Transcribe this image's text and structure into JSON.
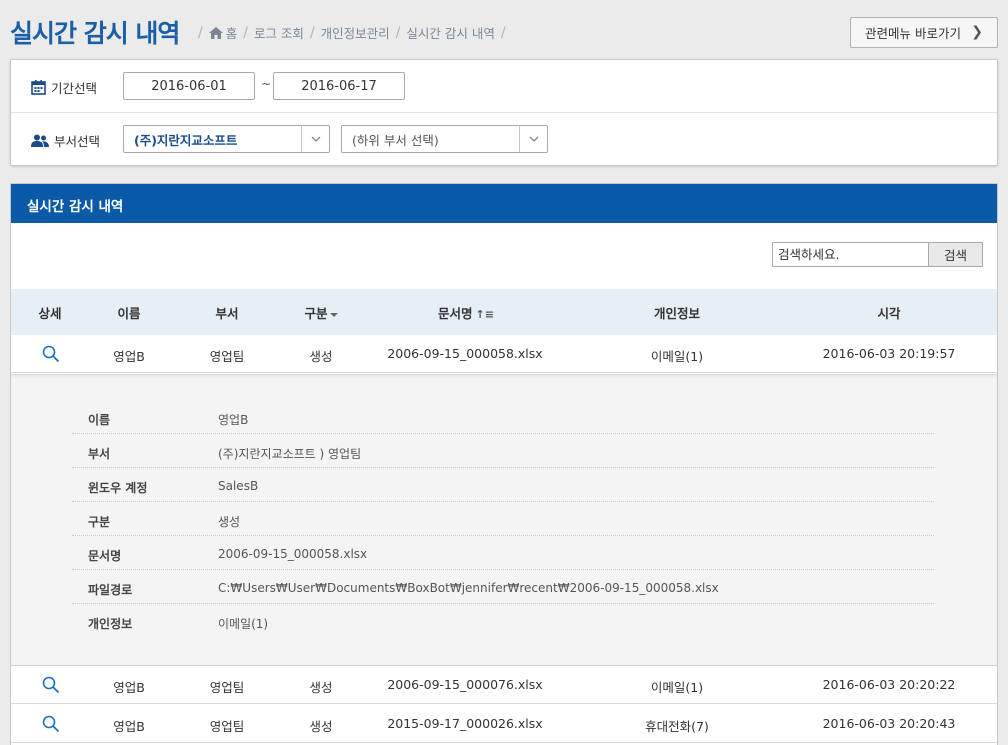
{
  "header": {
    "title": "실시간 감시 내역",
    "breadcrumb": [
      "홈",
      "로그 조회",
      "개인정보관리",
      "실시간 감시 내역"
    ],
    "related_button": "관련메뉴 바로가기"
  },
  "filter": {
    "period_label": "기간선택",
    "start_date": "2016-06-01",
    "separator": "~",
    "end_date": "2016-06-17",
    "dept_label": "부서선택",
    "dept_selected": "(주)지란지교소프트",
    "subdept_selected": "(하위 부서 선택)"
  },
  "panel": {
    "title": "실시간 감시 내역",
    "search_placeholder": "검색하세요.",
    "search_button": "검색"
  },
  "table": {
    "columns": [
      "상세",
      "이름",
      "부서",
      "구분",
      "문서명",
      "개인정보",
      "시각"
    ],
    "rows": [
      {
        "name": "영업B",
        "dept": "영업팀",
        "type": "생성",
        "doc": "2006-09-15_000058.xlsx",
        "pii": "이메일(1)",
        "time": "2016-06-03 20:19:57"
      },
      {
        "name": "영업B",
        "dept": "영업팀",
        "type": "생성",
        "doc": "2006-09-15_000076.xlsx",
        "pii": "이메일(1)",
        "time": "2016-06-03 20:20:22"
      },
      {
        "name": "영업B",
        "dept": "영업팀",
        "type": "생성",
        "doc": "2015-09-17_000026.xlsx",
        "pii": "휴대전화(7)",
        "time": "2016-06-03 20:20:43"
      }
    ]
  },
  "detail": [
    {
      "key": "이름",
      "value": "영업B"
    },
    {
      "key": "부서",
      "value": "(주)지란지교소프트 ) 영업팀"
    },
    {
      "key": "윈도우 계정",
      "value": "SalesB"
    },
    {
      "key": "구분",
      "value": "생성"
    },
    {
      "key": "문서명",
      "value": "2006-09-15_000058.xlsx"
    },
    {
      "key": "파일경로",
      "value": "C:₩Users₩User₩Documents₩BoxBot₩jennifer₩recent₩2006-09-15_000058.xlsx"
    },
    {
      "key": "개인정보",
      "value": "이메일(1)"
    }
  ],
  "icons": {
    "home": "home-icon",
    "calendar": "calendar-icon",
    "users": "users-icon",
    "magnifier": "magnifier-icon",
    "chevron": "chevron-right-icon"
  },
  "colors": {
    "title_blue": "#1a5fa8",
    "panel_header": "#0b5aa8",
    "table_header_bg": "#e6eef6",
    "icon_blue": "#1f6fbf"
  }
}
